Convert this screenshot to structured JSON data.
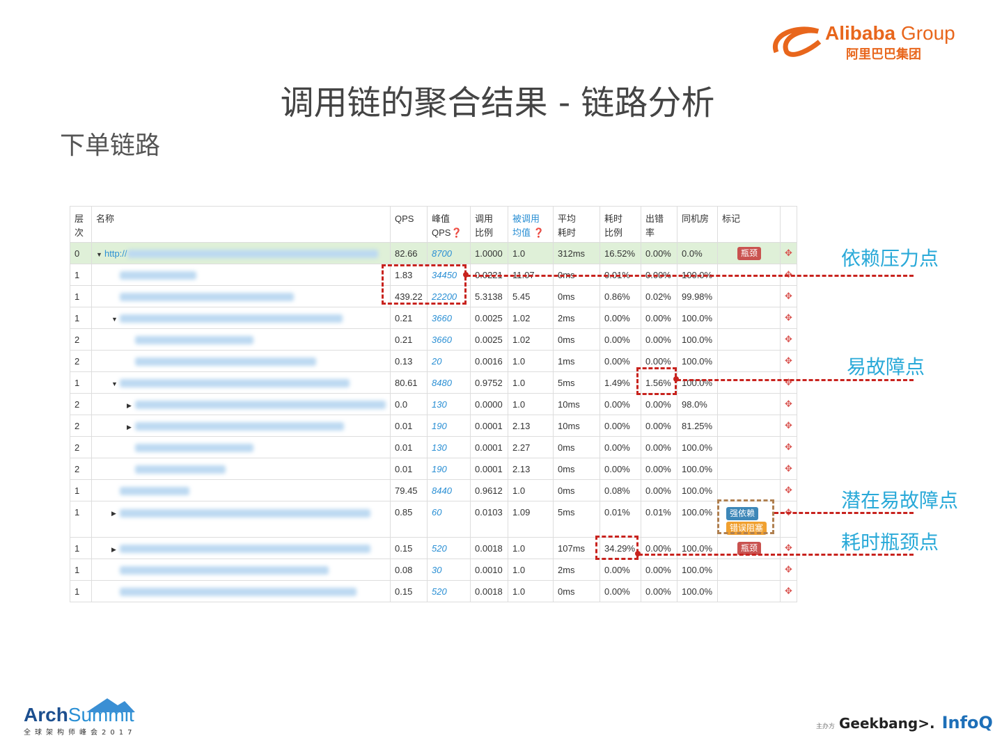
{
  "slide": {
    "title": "调用链的聚合结果 - 链路分析",
    "subtitle": "下单链路"
  },
  "logos": {
    "alibaba_en": "Alibaba",
    "alibaba_group": " Group",
    "alibaba_cn": "阿里巴巴集团",
    "archsummit_arch": "Arch",
    "archsummit_summit": "Summit",
    "archsummit_sub": "全球架构师峰会2017",
    "host_prefix": "主办方",
    "geekbang": "Geekbang>.",
    "infoq": "InfoQ"
  },
  "table": {
    "headers": [
      "层\n次",
      "名称",
      "QPS",
      "峰值\nQPS❓",
      "调用\n比例",
      "被调用\n均值 ❓",
      "平均\n耗时",
      "耗时\n比例",
      "出错\n率",
      "同机房",
      "标记",
      ""
    ],
    "rows": [
      {
        "level": "0",
        "prefix": "http://",
        "caret": "down",
        "indent": 0,
        "qps": "82.66",
        "peak": "8700",
        "ratio": "1.0000",
        "avg_called": "1.0",
        "avg_time": "312ms",
        "time_ratio": "16.52%",
        "err": "0.00%",
        "same_room": "0.0%",
        "marks": [
          "瓶颈"
        ]
      },
      {
        "level": "1",
        "caret": "",
        "indent": 1,
        "qps": "1.83",
        "peak": "34450",
        "ratio": "0.0221",
        "avg_called": "11.07",
        "avg_time": "0ms",
        "time_ratio": "0.01%",
        "err": "0.00%",
        "same_room": "100.0%",
        "marks": []
      },
      {
        "level": "1",
        "caret": "",
        "indent": 1,
        "qps": "439.22",
        "peak": "22200",
        "ratio": "5.3138",
        "avg_called": "5.45",
        "avg_time": "0ms",
        "time_ratio": "0.86%",
        "err": "0.02%",
        "same_room": "99.98%",
        "marks": []
      },
      {
        "level": "1",
        "caret": "down",
        "indent": 1,
        "qps": "0.21",
        "peak": "3660",
        "ratio": "0.0025",
        "avg_called": "1.02",
        "avg_time": "2ms",
        "time_ratio": "0.00%",
        "err": "0.00%",
        "same_room": "100.0%",
        "marks": []
      },
      {
        "level": "2",
        "caret": "",
        "indent": 2,
        "qps": "0.21",
        "peak": "3660",
        "ratio": "0.0025",
        "avg_called": "1.02",
        "avg_time": "0ms",
        "time_ratio": "0.00%",
        "err": "0.00%",
        "same_room": "100.0%",
        "marks": []
      },
      {
        "level": "2",
        "caret": "",
        "indent": 2,
        "qps": "0.13",
        "peak": "20",
        "ratio": "0.0016",
        "avg_called": "1.0",
        "avg_time": "1ms",
        "time_ratio": "0.00%",
        "err": "0.00%",
        "same_room": "100.0%",
        "marks": []
      },
      {
        "level": "1",
        "caret": "down",
        "indent": 1,
        "qps": "80.61",
        "peak": "8480",
        "ratio": "0.9752",
        "avg_called": "1.0",
        "avg_time": "5ms",
        "time_ratio": "1.49%",
        "err": "1.56%",
        "same_room": "100.0%",
        "marks": []
      },
      {
        "level": "2",
        "caret": "right",
        "indent": 2,
        "qps": "0.0",
        "peak": "130",
        "ratio": "0.0000",
        "avg_called": "1.0",
        "avg_time": "10ms",
        "time_ratio": "0.00%",
        "err": "0.00%",
        "same_room": "98.0%",
        "marks": []
      },
      {
        "level": "2",
        "caret": "right",
        "indent": 2,
        "qps": "0.01",
        "peak": "190",
        "ratio": "0.0001",
        "avg_called": "2.13",
        "avg_time": "10ms",
        "time_ratio": "0.00%",
        "err": "0.00%",
        "same_room": "81.25%",
        "marks": []
      },
      {
        "level": "2",
        "caret": "",
        "indent": 2,
        "qps": "0.01",
        "peak": "130",
        "ratio": "0.0001",
        "avg_called": "2.27",
        "avg_time": "0ms",
        "time_ratio": "0.00%",
        "err": "0.00%",
        "same_room": "100.0%",
        "marks": []
      },
      {
        "level": "2",
        "caret": "",
        "indent": 2,
        "qps": "0.01",
        "peak": "190",
        "ratio": "0.0001",
        "avg_called": "2.13",
        "avg_time": "0ms",
        "time_ratio": "0.00%",
        "err": "0.00%",
        "same_room": "100.0%",
        "marks": []
      },
      {
        "level": "1",
        "caret": "",
        "indent": 1,
        "qps": "79.45",
        "peak": "8440",
        "ratio": "0.9612",
        "avg_called": "1.0",
        "avg_time": "0ms",
        "time_ratio": "0.08%",
        "err": "0.00%",
        "same_room": "100.0%",
        "marks": []
      },
      {
        "level": "1",
        "caret": "right",
        "indent": 1,
        "qps": "0.85",
        "peak": "60",
        "ratio": "0.0103",
        "avg_called": "1.09",
        "avg_time": "5ms",
        "time_ratio": "0.01%",
        "err": "0.01%",
        "same_room": "100.0%",
        "marks": [
          "强依赖",
          "错误阻塞"
        ]
      },
      {
        "level": "1",
        "caret": "right",
        "indent": 1,
        "qps": "0.15",
        "peak": "520",
        "ratio": "0.0018",
        "avg_called": "1.0",
        "avg_time": "107ms",
        "time_ratio": "34.29%",
        "err": "0.00%",
        "same_room": "100.0%",
        "marks": [
          "瓶颈"
        ]
      },
      {
        "level": "1",
        "caret": "",
        "indent": 1,
        "qps": "0.08",
        "peak": "30",
        "ratio": "0.0010",
        "avg_called": "1.0",
        "avg_time": "2ms",
        "time_ratio": "0.00%",
        "err": "0.00%",
        "same_room": "100.0%",
        "marks": []
      },
      {
        "level": "1",
        "caret": "",
        "indent": 1,
        "qps": "0.15",
        "peak": "520",
        "ratio": "0.0018",
        "avg_called": "1.0",
        "avg_time": "0ms",
        "time_ratio": "0.00%",
        "err": "0.00%",
        "same_room": "100.0%",
        "marks": []
      }
    ]
  },
  "annotations": {
    "pressure": "依赖压力点",
    "fault": "易故障点",
    "latent": "潜在易故障点",
    "bottleneck": "耗时瓶颈点"
  },
  "colors": {
    "annotation_red": "#c8231e",
    "annotation_blue": "#29a9d8",
    "root_row": "#dff0d8",
    "link": "#2a8fd4",
    "mark_bottleneck": "#c9524f",
    "mark_strong": "#3d87b8",
    "mark_block": "#f0a030"
  },
  "icons": {
    "row_action": "locate-icon"
  }
}
